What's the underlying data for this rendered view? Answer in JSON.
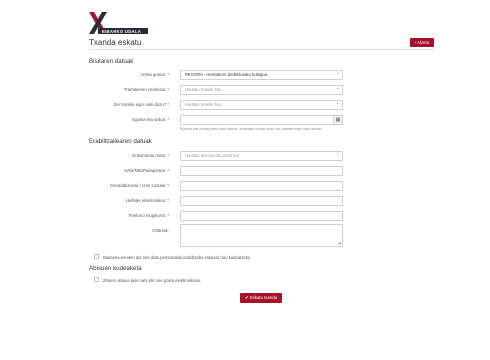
{
  "logo": {
    "text": "EIBARKO UDALA"
  },
  "page": {
    "title": "Txanda eskatu",
    "back_label": "‹ Atzera"
  },
  "sections": {
    "service": "Bisitaren datuak",
    "user": "Erabiltzailearen datuak",
    "notice": "Abisuen kudeaketa"
  },
  "form": {
    "area": {
      "label": "Arreta gunea: *",
      "value": "PEGORA - Herritarren Zerbitzurako bulegoa"
    },
    "procedure": {
      "label": "Tramiteeren zerikusia: *",
      "value": "Hautatu tramite bat..."
    },
    "service_type": {
      "label": "Zer tramite egin nahi duzu? *",
      "value": "Hautatu tramite bat..."
    },
    "date": {
      "label": "Egunia eta ordua: *",
      "value": "",
      "icon": "calendar-icon",
      "help": "Egunia eta ordua hartu bahi behar, aukeratu behar duzu zer tramite egin nahi duzun."
    },
    "doc_type": {
      "label": "Dokumentu mota: *",
      "value": "Hautatu dokumentu mota bat"
    },
    "doc_number": {
      "label": "NAN/NIE/Pasaportea: *",
      "value": ""
    },
    "name": {
      "label": "Izena/abizenak / Izen soziala: *",
      "value": ""
    },
    "email": {
      "label": "Helbide elektronikoa: *",
      "value": ""
    },
    "phone": {
      "label": "Telefono mugikorra: *",
      "value": ""
    },
    "notes": {
      "label": "Oharrak:",
      "value": ""
    }
  },
  "consent": {
    "privacy_label": "Baimena ematen dut nire datu pertsonalak erabiltzeko eskaera hau kudeatzeko"
  },
  "notify": {
    "email_label": "Zitaren abisua jaso nahi dut nire posta elektronikoan."
  },
  "submit": {
    "label": "✔ Eskatu txanda"
  },
  "colors": {
    "accent": "#a8112a"
  }
}
